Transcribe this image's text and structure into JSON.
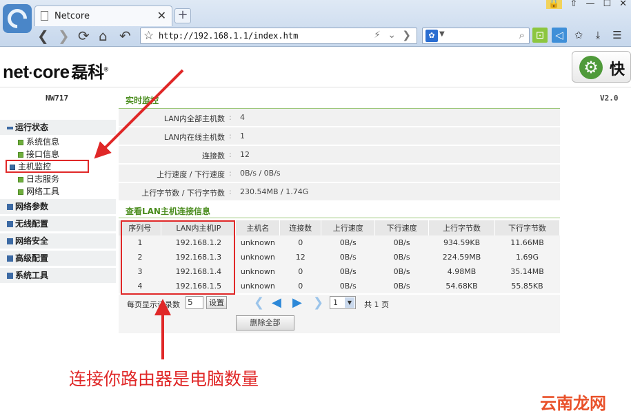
{
  "browser": {
    "tab_title": "Netcore",
    "tab_close": "✕",
    "new_tab": "+",
    "url": "http://192.168.1.1/index.htm"
  },
  "header": {
    "logo_text": "net",
    "logo_text2": "core",
    "logo_cn": "磊科",
    "logo_reg": "®",
    "quick_label": "快"
  },
  "model": "NW717",
  "version": "V2.0",
  "sidebar": {
    "sections": [
      {
        "label": "运行状态",
        "expanded": true
      },
      {
        "label": "网络参数"
      },
      {
        "label": "无线配置"
      },
      {
        "label": "网络安全"
      },
      {
        "label": "高级配置"
      },
      {
        "label": "系统工具"
      }
    ],
    "sub_items": [
      "系统信息",
      "接口信息",
      "主机监控",
      "日志服务",
      "网络工具"
    ]
  },
  "realtime": {
    "title": "实时监控",
    "rows": [
      {
        "key": "LAN内全部主机数",
        "value": "4"
      },
      {
        "key": "LAN内在线主机数",
        "value": "1"
      },
      {
        "key": "连接数",
        "value": "12"
      },
      {
        "key": "上行速度 / 下行速度",
        "value": "0B/s / 0B/s"
      },
      {
        "key": "上行字节数 / 下行字节数",
        "value": "230.54MB / 1.74G"
      }
    ]
  },
  "hosts": {
    "title": "查看LAN主机连接信息",
    "columns": [
      "序列号",
      "LAN内主机IP",
      "主机名",
      "连接数",
      "上行速度",
      "下行速度",
      "上行字节数",
      "下行字节数"
    ],
    "rows": [
      [
        "1",
        "192.168.1.2",
        "unknown",
        "0",
        "0B/s",
        "0B/s",
        "934.59KB",
        "11.66MB"
      ],
      [
        "2",
        "192.168.1.3",
        "unknown",
        "12",
        "0B/s",
        "0B/s",
        "224.59MB",
        "1.69G"
      ],
      [
        "3",
        "192.168.1.4",
        "unknown",
        "0",
        "0B/s",
        "0B/s",
        "4.98MB",
        "35.14MB"
      ],
      [
        "4",
        "192.168.1.5",
        "unknown",
        "0",
        "0B/s",
        "0B/s",
        "54.68KB",
        "55.85KB"
      ]
    ]
  },
  "pager": {
    "per_page_label": "每页显示记录数",
    "per_page_value": "5",
    "set_label": "设置",
    "page_value": "1",
    "total_label": "共 1 页",
    "delete_all": "删除全部"
  },
  "annotation": "连接你路由器是电脑数量",
  "watermark": "云南龙网",
  "colors": {
    "accent_green": "#4b8d1f",
    "highlight_red": "#e02828",
    "pager_blue": "#2c88d8"
  }
}
